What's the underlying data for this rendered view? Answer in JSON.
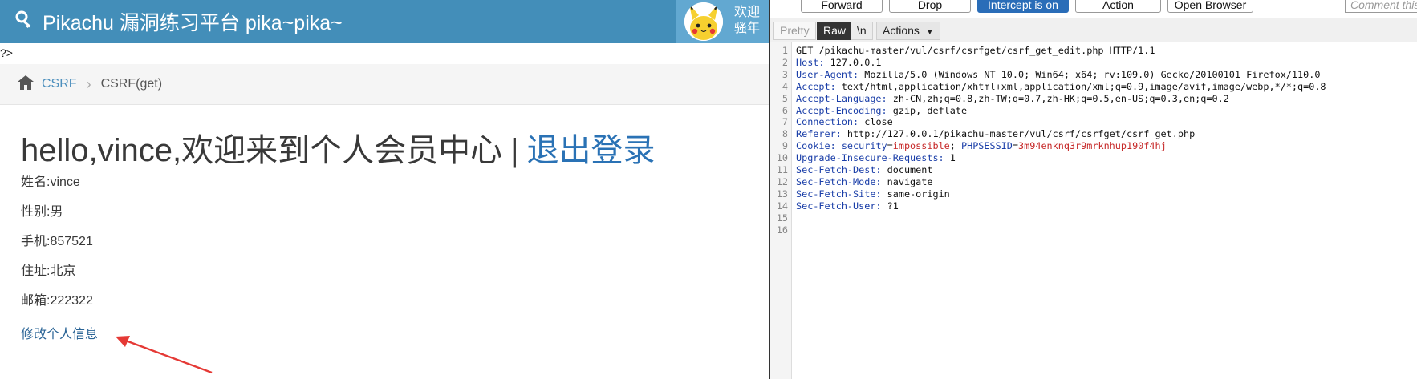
{
  "site": {
    "title": "Pikachu 漏洞练习平台 pika~pika~",
    "welcome_line1": "欢迎",
    "welcome_line2": "骚年",
    "php_tag": "?>",
    "breadcrumb": {
      "section": "CSRF",
      "current": "CSRF(get)"
    },
    "greeting": "hello,vince,欢迎来到个人会员中心",
    "separator": "|",
    "logout": "退出登录",
    "profile": {
      "name": "姓名:vince",
      "gender": "性别:男",
      "phone": "手机:857521",
      "address": "住址:北京",
      "email": "邮箱:222322"
    },
    "edit_link": "修改个人信息",
    "colors": {
      "topbar": "#438eb9",
      "user_box": "#62a8d1",
      "arrow": "#e53935"
    }
  },
  "burp": {
    "buttons": {
      "forward": "Forward",
      "drop": "Drop",
      "intercept": "Intercept is on",
      "action": "Action",
      "open_browser": "Open Browser"
    },
    "comment_placeholder": "Comment this",
    "tabs": {
      "pretty": "Pretty",
      "raw": "Raw",
      "newline": "\\n",
      "actions": "Actions"
    },
    "request_lines": [
      {
        "n": "1",
        "plain": "GET /pikachu-master/vul/csrf/csrfget/csrf_get_edit.php HTTP/1.1"
      },
      {
        "n": "2",
        "key": "Host:",
        "val": " 127.0.0.1"
      },
      {
        "n": "3",
        "key": "User-Agent:",
        "val": " Mozilla/5.0 (Windows NT 10.0; Win64; x64; rv:109.0) Gecko/20100101 Firefox/110.0"
      },
      {
        "n": "4",
        "key": "Accept:",
        "val": " text/html,application/xhtml+xml,application/xml;q=0.9,image/avif,image/webp,*/*;q=0.8"
      },
      {
        "n": "5",
        "key": "Accept-Language:",
        "val": " zh-CN,zh;q=0.8,zh-TW;q=0.7,zh-HK;q=0.5,en-US;q=0.3,en;q=0.2"
      },
      {
        "n": "6",
        "key": "Accept-Encoding:",
        "val": " gzip, deflate"
      },
      {
        "n": "7",
        "key": "Connection:",
        "val": " close"
      },
      {
        "n": "8",
        "key": "Referer:",
        "val": " http://127.0.0.1/pikachu-master/vul/csrf/csrfget/csrf_get.php"
      },
      {
        "n": "9",
        "key": "Cookie:",
        "c1k": " security",
        "c1v": "impossible",
        "c2k": " PHPSESSID",
        "c2v": "3m94enknq3r9mrknhup190f4hj"
      },
      {
        "n": "10",
        "key": "Upgrade-Insecure-Requests:",
        "val": " 1"
      },
      {
        "n": "11",
        "key": "Sec-Fetch-Dest:",
        "val": " document"
      },
      {
        "n": "12",
        "key": "Sec-Fetch-Mode:",
        "val": " navigate"
      },
      {
        "n": "13",
        "key": "Sec-Fetch-Site:",
        "val": " same-origin"
      },
      {
        "n": "14",
        "key": "Sec-Fetch-User:",
        "val": " ?1"
      },
      {
        "n": "15"
      },
      {
        "n": "16"
      }
    ]
  }
}
